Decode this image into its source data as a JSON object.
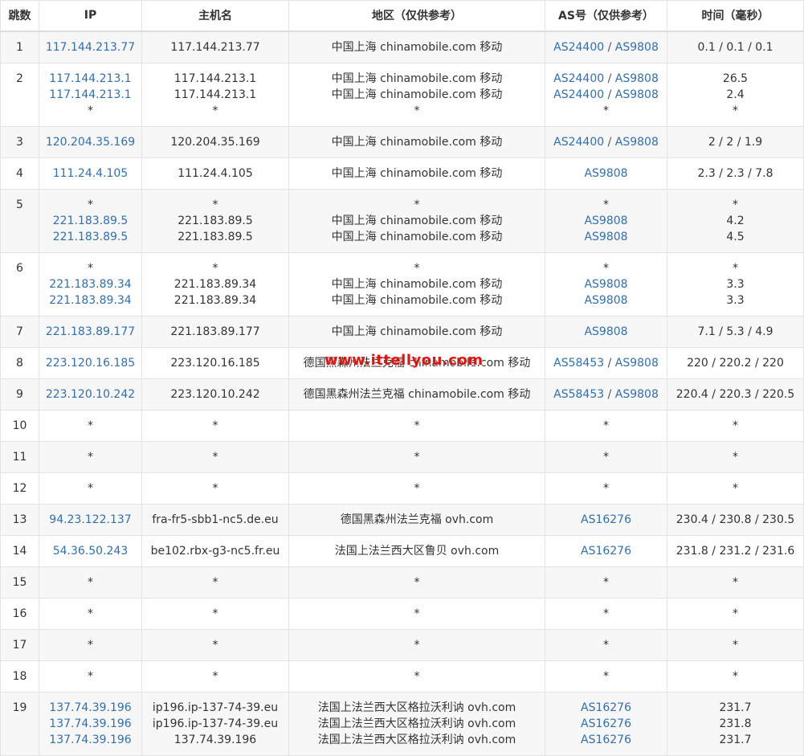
{
  "columns": {
    "hop": "跳数",
    "ip": "IP",
    "hostname": "主机名",
    "region": "地区（仅供参考）",
    "as": "AS号（仅供参考）",
    "time": "时间（毫秒）"
  },
  "watermark": "www.ittellyou.com",
  "rows": [
    {
      "hop": "1",
      "lines": [
        {
          "ip": "117.144.213.77",
          "hostname": "117.144.213.77",
          "region": "中国上海 chinamobile.com 移动",
          "as": [
            "AS24400",
            "AS9808"
          ]
        }
      ],
      "time": [
        "0.1 / 0.1 / 0.1"
      ]
    },
    {
      "hop": "2",
      "lines": [
        {
          "ip": "117.144.213.1",
          "hostname": "117.144.213.1",
          "region": "中国上海 chinamobile.com 移动",
          "as": [
            "AS24400",
            "AS9808"
          ]
        },
        {
          "ip": "117.144.213.1",
          "hostname": "117.144.213.1",
          "region": "中国上海 chinamobile.com 移动",
          "as": [
            "AS24400",
            "AS9808"
          ]
        },
        {
          "ip": "*",
          "hostname": "*",
          "region": "*",
          "as": [
            "*"
          ]
        }
      ],
      "time": [
        "26.5",
        "2.4",
        "*"
      ]
    },
    {
      "hop": "3",
      "lines": [
        {
          "ip": "120.204.35.169",
          "hostname": "120.204.35.169",
          "region": "中国上海 chinamobile.com 移动",
          "as": [
            "AS24400",
            "AS9808"
          ]
        }
      ],
      "time": [
        "2 / 2 / 1.9"
      ]
    },
    {
      "hop": "4",
      "lines": [
        {
          "ip": "111.24.4.105",
          "hostname": "111.24.4.105",
          "region": "中国上海 chinamobile.com 移动",
          "as": [
            "AS9808"
          ]
        }
      ],
      "time": [
        "2.3 / 2.3 / 7.8"
      ]
    },
    {
      "hop": "5",
      "lines": [
        {
          "ip": "*",
          "hostname": "*",
          "region": "*",
          "as": [
            "*"
          ]
        },
        {
          "ip": "221.183.89.5",
          "hostname": "221.183.89.5",
          "region": "中国上海 chinamobile.com 移动",
          "as": [
            "AS9808"
          ]
        },
        {
          "ip": "221.183.89.5",
          "hostname": "221.183.89.5",
          "region": "中国上海 chinamobile.com 移动",
          "as": [
            "AS9808"
          ]
        }
      ],
      "time": [
        "*",
        "4.2",
        "4.5"
      ]
    },
    {
      "hop": "6",
      "lines": [
        {
          "ip": "*",
          "hostname": "*",
          "region": "*",
          "as": [
            "*"
          ]
        },
        {
          "ip": "221.183.89.34",
          "hostname": "221.183.89.34",
          "region": "中国上海 chinamobile.com 移动",
          "as": [
            "AS9808"
          ]
        },
        {
          "ip": "221.183.89.34",
          "hostname": "221.183.89.34",
          "region": "中国上海 chinamobile.com 移动",
          "as": [
            "AS9808"
          ]
        }
      ],
      "time": [
        "*",
        "3.3",
        "3.3"
      ]
    },
    {
      "hop": "7",
      "lines": [
        {
          "ip": "221.183.89.177",
          "hostname": "221.183.89.177",
          "region": "中国上海 chinamobile.com 移动",
          "as": [
            "AS9808"
          ]
        }
      ],
      "time": [
        "7.1 / 5.3 / 4.9"
      ]
    },
    {
      "hop": "8",
      "lines": [
        {
          "ip": "223.120.16.185",
          "hostname": "223.120.16.185",
          "region": "德国黑森州法兰克福 chinamobile.com 移动",
          "as": [
            "AS58453",
            "AS9808"
          ]
        }
      ],
      "time": [
        "220 / 220.2 / 220"
      ]
    },
    {
      "hop": "9",
      "lines": [
        {
          "ip": "223.120.10.242",
          "hostname": "223.120.10.242",
          "region": "德国黑森州法兰克福 chinamobile.com 移动",
          "as": [
            "AS58453",
            "AS9808"
          ]
        }
      ],
      "time": [
        "220.4 / 220.3 / 220.5"
      ]
    },
    {
      "hop": "10",
      "lines": [
        {
          "ip": "*",
          "hostname": "*",
          "region": "*",
          "as": [
            "*"
          ]
        }
      ],
      "time": [
        "*"
      ]
    },
    {
      "hop": "11",
      "lines": [
        {
          "ip": "*",
          "hostname": "*",
          "region": "*",
          "as": [
            "*"
          ]
        }
      ],
      "time": [
        "*"
      ]
    },
    {
      "hop": "12",
      "lines": [
        {
          "ip": "*",
          "hostname": "*",
          "region": "*",
          "as": [
            "*"
          ]
        }
      ],
      "time": [
        "*"
      ]
    },
    {
      "hop": "13",
      "lines": [
        {
          "ip": "94.23.122.137",
          "hostname": "fra-fr5-sbb1-nc5.de.eu",
          "region": "德国黑森州法兰克福 ovh.com",
          "as": [
            "AS16276"
          ]
        }
      ],
      "time": [
        "230.4 / 230.8 / 230.5"
      ]
    },
    {
      "hop": "14",
      "lines": [
        {
          "ip": "54.36.50.243",
          "hostname": "be102.rbx-g3-nc5.fr.eu",
          "region": "法国上法兰西大区鲁贝 ovh.com",
          "as": [
            "AS16276"
          ]
        }
      ],
      "time": [
        "231.8 / 231.2 / 231.6"
      ]
    },
    {
      "hop": "15",
      "lines": [
        {
          "ip": "*",
          "hostname": "*",
          "region": "*",
          "as": [
            "*"
          ]
        }
      ],
      "time": [
        "*"
      ]
    },
    {
      "hop": "16",
      "lines": [
        {
          "ip": "*",
          "hostname": "*",
          "region": "*",
          "as": [
            "*"
          ]
        }
      ],
      "time": [
        "*"
      ]
    },
    {
      "hop": "17",
      "lines": [
        {
          "ip": "*",
          "hostname": "*",
          "region": "*",
          "as": [
            "*"
          ]
        }
      ],
      "time": [
        "*"
      ]
    },
    {
      "hop": "18",
      "lines": [
        {
          "ip": "*",
          "hostname": "*",
          "region": "*",
          "as": [
            "*"
          ]
        }
      ],
      "time": [
        "*"
      ]
    },
    {
      "hop": "19",
      "lines": [
        {
          "ip": "137.74.39.196",
          "hostname": "ip196.ip-137-74-39.eu",
          "region": "法国上法兰西大区格拉沃利讷 ovh.com",
          "as": [
            "AS16276"
          ]
        },
        {
          "ip": "137.74.39.196",
          "hostname": "ip196.ip-137-74-39.eu",
          "region": "法国上法兰西大区格拉沃利讷 ovh.com",
          "as": [
            "AS16276"
          ]
        },
        {
          "ip": "137.74.39.196",
          "hostname": "137.74.39.196",
          "region": "法国上法兰西大区格拉沃利讷 ovh.com",
          "as": [
            "AS16276"
          ]
        }
      ],
      "time": [
        "231.7",
        "231.8",
        "231.7"
      ]
    }
  ]
}
